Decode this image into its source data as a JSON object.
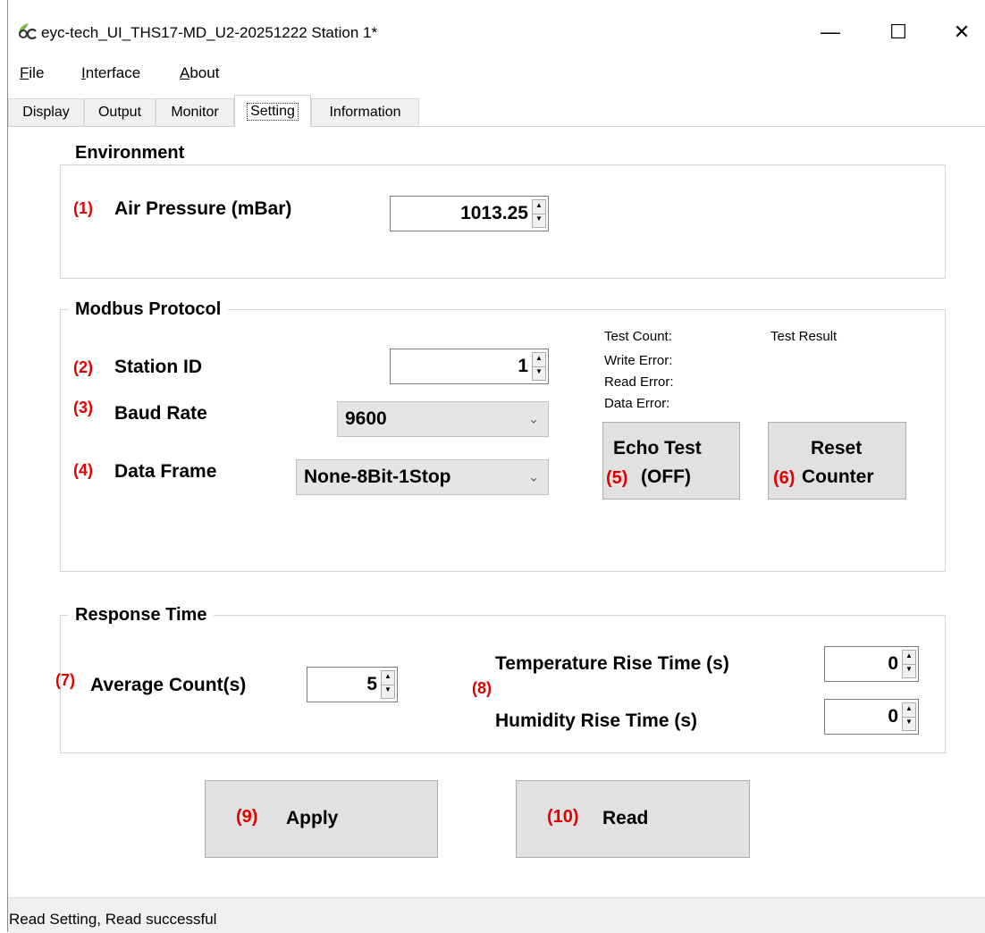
{
  "window": {
    "title": "eyc-tech_UI_THS17-MD_U2-20251222  Station 1*",
    "minimize": "—",
    "maximize": "☐",
    "close": "✕"
  },
  "menu": {
    "file": "File",
    "interface": "Interface",
    "about": "About"
  },
  "tabs": [
    "Display",
    "Output",
    "Monitor",
    "Setting",
    "Information"
  ],
  "active_tab": "Setting",
  "environment": {
    "title": "Environment",
    "air_pressure": {
      "num": "(1)",
      "label": "Air Pressure (mBar)",
      "value": "1013.25"
    }
  },
  "modbus": {
    "title": "Modbus Protocol",
    "station_id": {
      "num": "(2)",
      "label": "Station ID",
      "value": "1"
    },
    "baud_rate": {
      "num": "(3)",
      "label": "Baud Rate",
      "value": "9600"
    },
    "data_frame": {
      "num": "(4)",
      "label": "Data Frame",
      "value": "None-8Bit-1Stop"
    },
    "test_count": "Test Count:",
    "test_result": "Test Result",
    "write_error": "Write Error:",
    "read_error": "Read Error:",
    "data_error": "Data Error:",
    "echo_test": {
      "num": "(5)",
      "line1": "Echo Test",
      "line2": "(OFF)"
    },
    "reset_counter": {
      "num": "(6)",
      "line1": "Reset",
      "line2": "Counter"
    }
  },
  "response": {
    "title": "Response Time",
    "average_count": {
      "num": "(7)",
      "label": "Average Count(s)",
      "value": "5"
    },
    "num8": "(8)",
    "temp_rise": {
      "label": "Temperature Rise Time (s)",
      "value": "0"
    },
    "humidity_rise": {
      "label": "Humidity Rise Time (s)",
      "value": "0"
    }
  },
  "actions": {
    "apply": {
      "num": "(9)",
      "label": "Apply"
    },
    "read": {
      "num": "(10)",
      "label": "Read"
    }
  },
  "status": "Read Setting,   Read successful"
}
